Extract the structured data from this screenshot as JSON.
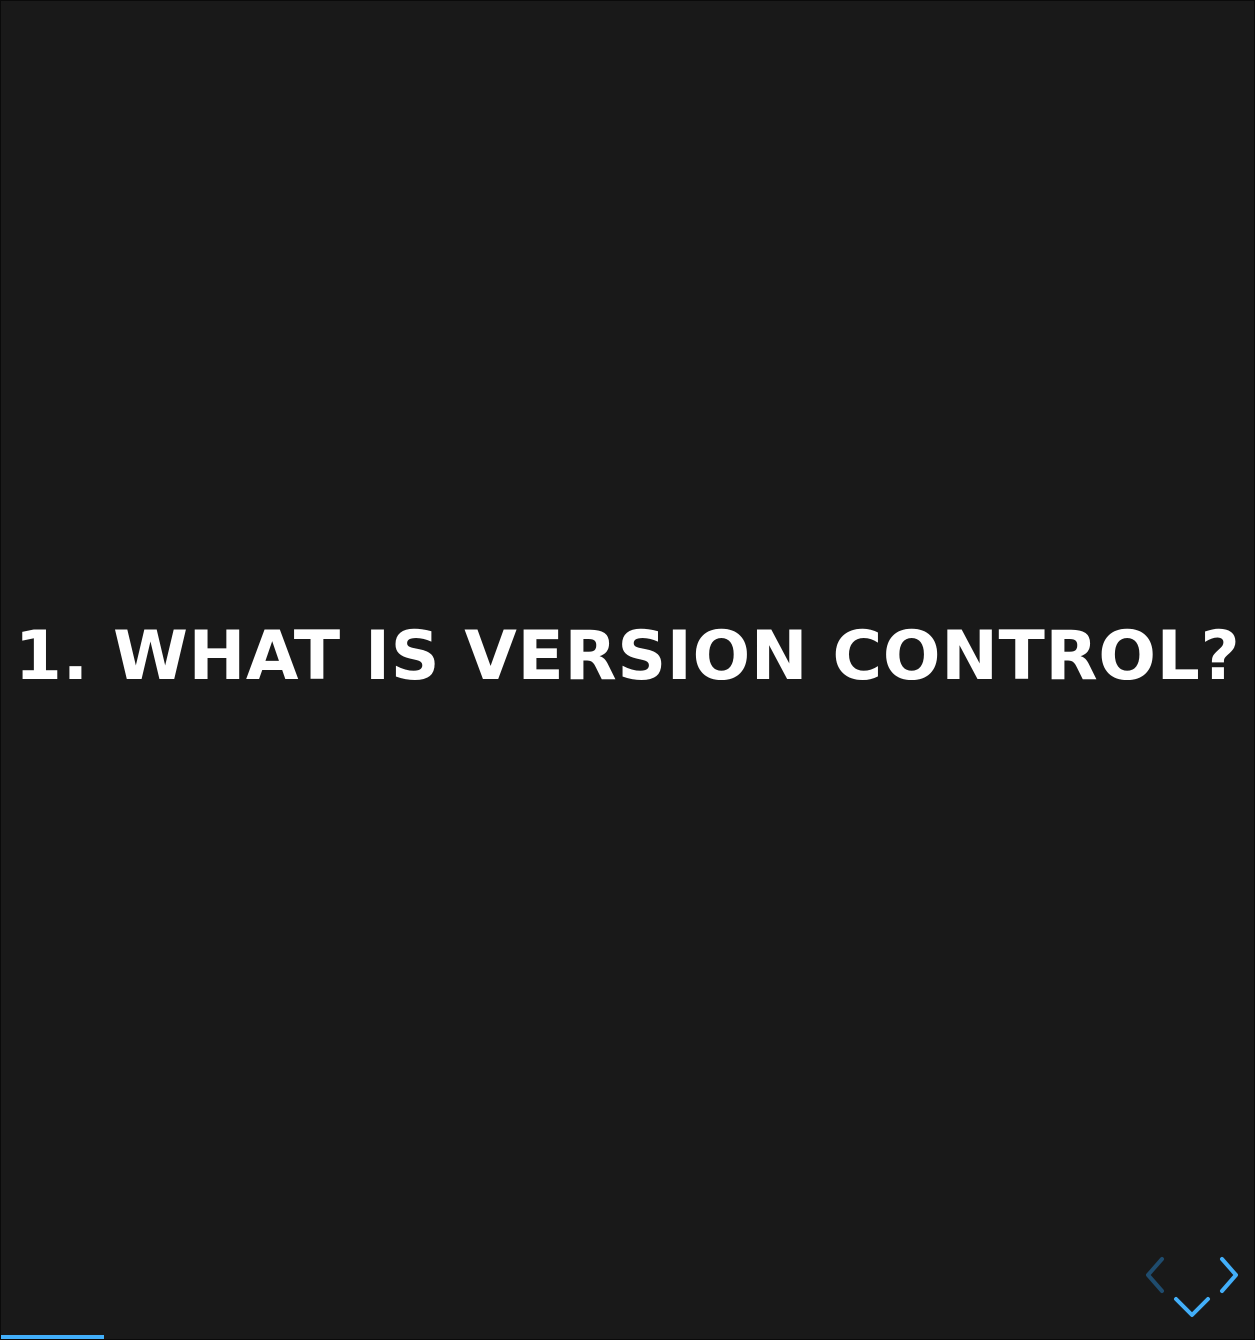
{
  "slide": {
    "title": "1. WHAT IS VERSION CONTROL?"
  },
  "controls": {
    "prev_icon": "chevron-left-icon",
    "next_icon": "chevron-right-icon",
    "down_icon": "chevron-down-icon",
    "active_color": "#42affa",
    "disabled_color": "#1f4c6e"
  },
  "progress": {
    "fraction": 0.082,
    "color": "#42affa"
  },
  "theme": {
    "background": "#191919",
    "text_color": "#ffffff"
  }
}
